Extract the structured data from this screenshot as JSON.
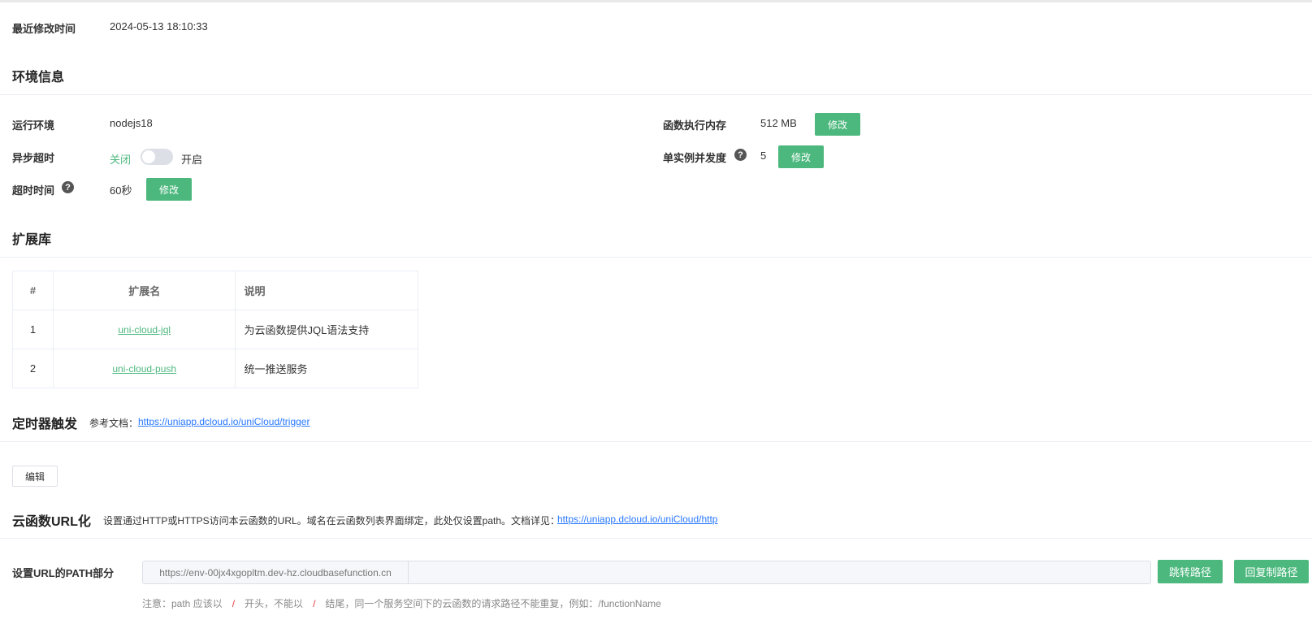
{
  "basic": {
    "modified_label": "最近修改时间",
    "modified_value": "2024-05-13 18:10:33"
  },
  "env": {
    "title": "环境信息",
    "runtime_label": "运行环境",
    "runtime_value": "nodejs18",
    "async_label": "异步超时",
    "async_off": "关闭",
    "async_on": "开启",
    "timeout_label": "超时时间",
    "timeout_value": "60秒",
    "memory_label": "函数执行内存",
    "memory_value": "512 MB",
    "concurrency_label": "单实例并发度",
    "concurrency_value": "5",
    "modify_label": "修改",
    "help_glyph": "?"
  },
  "ext": {
    "title": "扩展库",
    "headers": [
      "#",
      "扩展名",
      "说明"
    ],
    "rows": [
      {
        "index": "1",
        "name": "uni-cloud-jql",
        "desc": "为云函数提供JQL语法支持"
      },
      {
        "index": "2",
        "name": "uni-cloud-push",
        "desc": "统一推送服务"
      }
    ]
  },
  "timer": {
    "title": "定时器触发",
    "doc_label": "参考文档：",
    "doc_link": "https://uniapp.dcloud.io/uniCloud/trigger",
    "edit_label": "编辑"
  },
  "url": {
    "title": "云函数URL化",
    "desc": "设置通过HTTP或HTTPS访问本云函数的URL。域名在云函数列表界面绑定，此处仅设置path。文档详见：",
    "doc_link": "https://uniapp.dcloud.io/uniCloud/http",
    "path_label": "设置URL的PATH部分",
    "prefix": "https://env-00jx4xgopltm.dev-hz.cloudbasefunction.cn",
    "path_value": "",
    "jump_label": "跳转路径",
    "copy_label": "回复制路径",
    "note_part1": "注意：path 应该以",
    "note_slash": "/",
    "note_part2": "开头，不能以",
    "note_part3": "结尾，同一个服务空间下的云函数的请求路径不能重复，例如：/functionName"
  },
  "colors": {
    "accent": "#4db87e",
    "link": "#2979ff"
  }
}
